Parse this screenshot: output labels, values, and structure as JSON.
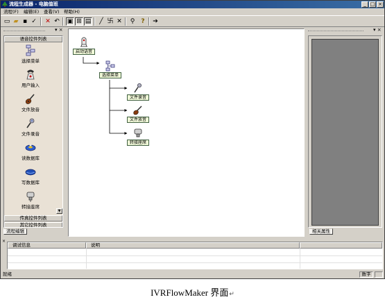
{
  "_note": "Source image is very low resolution; Chinese UI labels are approximate reconstructions.",
  "window": {
    "title": "流程生成器 - 电脑值班",
    "minimize_glyph": "_",
    "maximize_glyph": "□",
    "close_glyph": "×"
  },
  "menu": [
    {
      "label": "流程(F)"
    },
    {
      "label": "编辑(E)"
    },
    {
      "label": "查看(V)"
    },
    {
      "label": "帮助(H)"
    }
  ],
  "toolbar": [
    {
      "icon": "new-file-icon",
      "glyph": "▭"
    },
    {
      "icon": "open-folder-icon",
      "glyph": "▰"
    },
    {
      "icon": "save-icon",
      "glyph": "▪"
    },
    {
      "icon": "check-icon",
      "glyph": "✓"
    },
    {
      "icon": "delete-icon",
      "glyph": "✕",
      "color": "#c00000"
    },
    {
      "icon": "undo-icon",
      "glyph": "↶"
    },
    {
      "icon": "view-a-icon",
      "glyph": "▣",
      "pressed": true
    },
    {
      "icon": "view-b-icon",
      "glyph": "⊞",
      "pressed": true
    },
    {
      "icon": "view-c-icon",
      "glyph": "▤",
      "pressed": true
    },
    {
      "icon": "line-icon",
      "glyph": "╱"
    },
    {
      "icon": "route-icon",
      "glyph": "卐"
    },
    {
      "icon": "cross-icon",
      "glyph": "✕"
    },
    {
      "icon": "search-icon",
      "glyph": "⚲"
    },
    {
      "icon": "help-icon",
      "glyph": "?",
      "color": "#806000"
    },
    {
      "icon": "arrow-right-icon",
      "glyph": "➔"
    }
  ],
  "left_panel": {
    "grip_controls": "▾ ×",
    "group_title": "语音控件列表",
    "items": [
      {
        "label": "选择菜单",
        "icon": "menu-select-icon"
      },
      {
        "label": "用户输入",
        "icon": "user-input-icon"
      },
      {
        "label": "文件放音",
        "icon": "play-file-icon"
      },
      {
        "label": "文件录音",
        "icon": "record-file-icon"
      },
      {
        "label": "读数据库",
        "icon": "read-db-icon"
      },
      {
        "label": "写数据库",
        "icon": "write-db-icon"
      },
      {
        "label": "转接座席",
        "icon": "transfer-agent-icon"
      }
    ],
    "scroll_glyph": "▼",
    "other_groups": [
      "传真控件列表",
      "其它控件列表"
    ],
    "bottom_tab": "流程编辑"
  },
  "canvas": {
    "nodes": [
      {
        "id": "start",
        "label": "启动语音",
        "icon": "start-voice-icon"
      },
      {
        "id": "menu",
        "label": "选择菜单",
        "icon": "menu-select-icon"
      },
      {
        "id": "record",
        "label": "文件录音",
        "icon": "record-file-icon"
      },
      {
        "id": "play",
        "label": "文件放音",
        "icon": "play-file-icon"
      },
      {
        "id": "transfer",
        "label": "转接座席",
        "icon": "transfer-agent-icon"
      }
    ]
  },
  "right_panel": {
    "grip_controls": "▾ ×",
    "tab": "相关属性"
  },
  "output": {
    "columns": [
      "调试信息",
      "说明"
    ]
  },
  "status": {
    "text": "就绪",
    "panes": [
      "数字"
    ]
  },
  "caption": {
    "text": "IVRFlowMaker 界面",
    "return_mark": "↵"
  }
}
